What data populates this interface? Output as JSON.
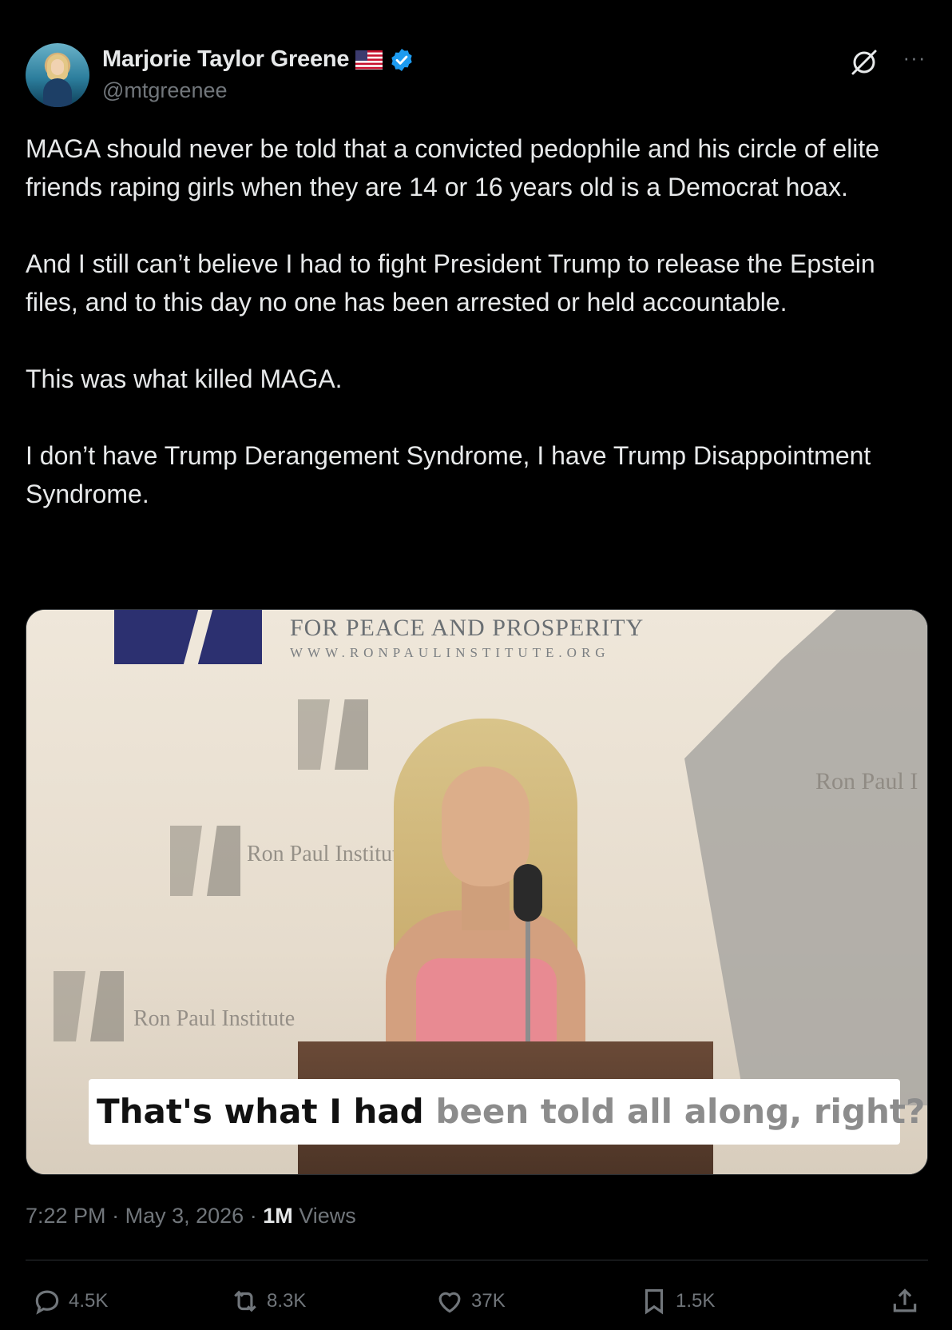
{
  "author": {
    "display_name": "Marjorie Taylor Greene",
    "handle": "@mtgreenee",
    "flag": "us-flag-icon",
    "verified": "verified-badge-icon"
  },
  "header_icons": {
    "grok": "grok-icon",
    "more": "···"
  },
  "tweet": {
    "paragraphs": [
      "MAGA should never be told that a convicted pedophile and his circle of elite friends raping girls when they are 14 or 16 years old is a Democrat hoax.",
      "And I still can’t believe I had to fight President Trump to release the Epstein files, and to this day no one has been arrested or held accountable.",
      "This was what killed MAGA.",
      "I don’t have Trump Derangement Syndrome, I have Trump Disappointment Syndrome."
    ]
  },
  "media": {
    "banner_title": "FOR PEACE AND PROSPERITY",
    "banner_url": "WWW.RONPAULINSTITUTE.ORG",
    "ghost_labels": [
      "Ron Paul Institute",
      "Ron Paul Institute",
      "Ron Paul I"
    ],
    "caption_spoken": "That's what I had ",
    "caption_pending": "been told all along, right?"
  },
  "meta": {
    "time": "7:22 PM",
    "date": "May 3, 2026",
    "separator": "·",
    "views_count": "1M",
    "views_label": "Views"
  },
  "actions": {
    "replies": "4.5K",
    "reposts": "8.3K",
    "likes": "37K",
    "bookmarks": "1.5K"
  },
  "colors": {
    "background": "#000000",
    "text": "#e7e9ea",
    "secondary": "#71767b",
    "verified": "#1d9bf0",
    "divider": "#2f3336"
  }
}
